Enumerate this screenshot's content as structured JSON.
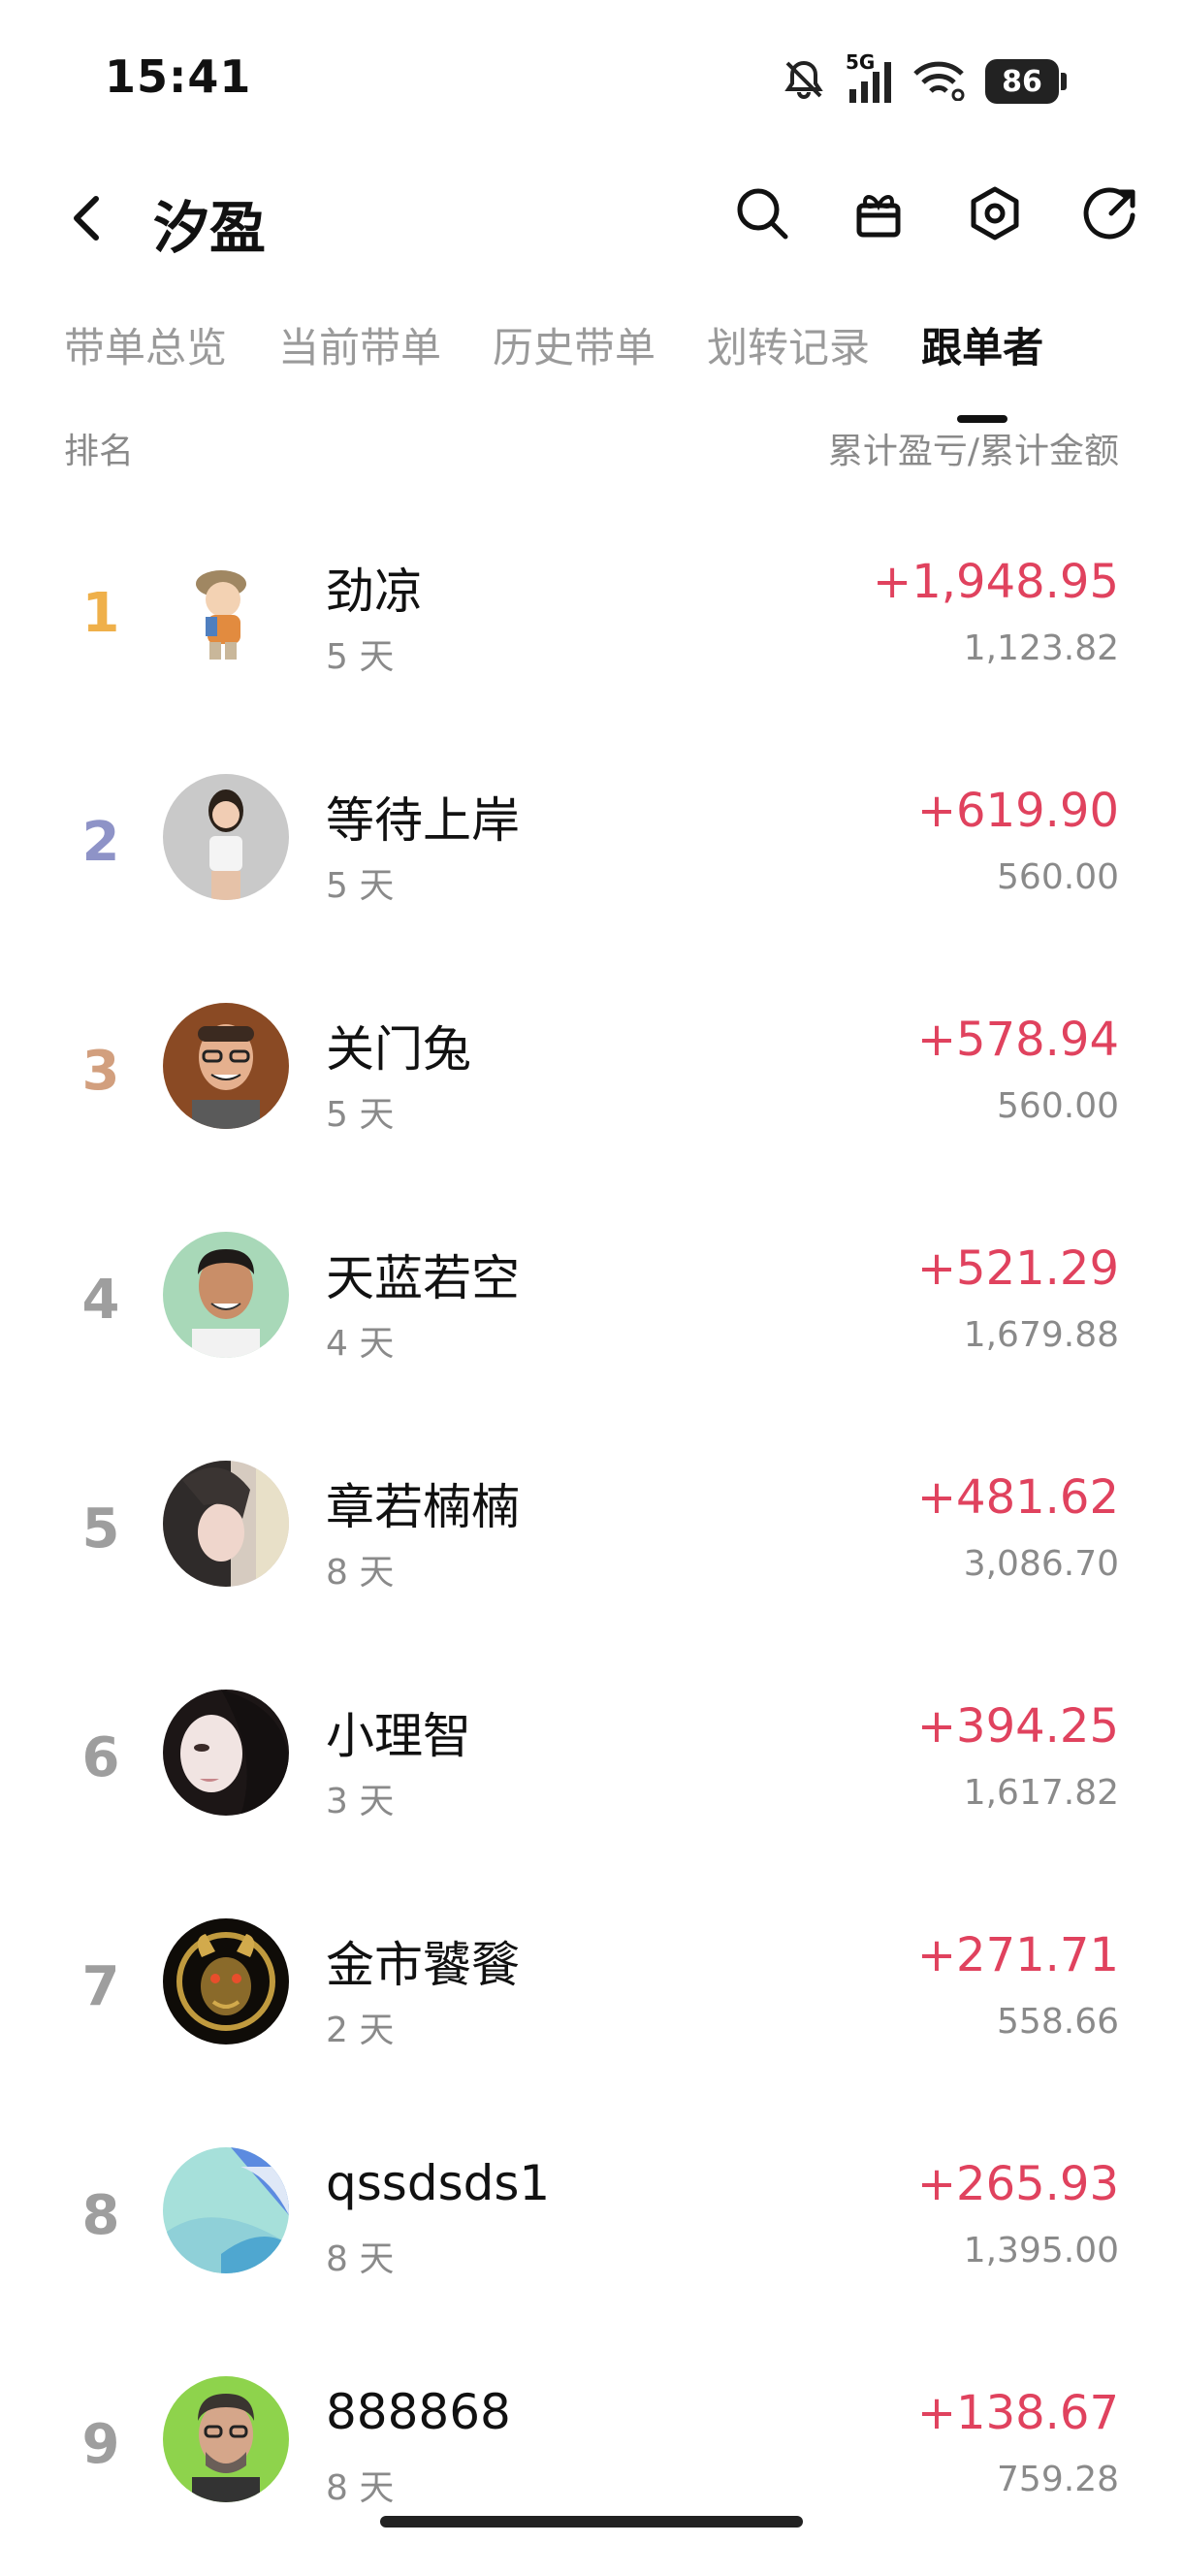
{
  "status_bar": {
    "time": "15:41",
    "network": "5G",
    "battery": "86"
  },
  "header": {
    "title": "汐盈",
    "icons": [
      "back-icon",
      "search-icon",
      "gift-icon",
      "settings-icon",
      "share-icon"
    ]
  },
  "tabs": [
    {
      "label": "带单总览",
      "active": false
    },
    {
      "label": "当前带单",
      "active": false
    },
    {
      "label": "历史带单",
      "active": false
    },
    {
      "label": "划转记录",
      "active": false
    },
    {
      "label": "跟单者",
      "active": true
    }
  ],
  "columns": {
    "left": "排名",
    "right": "累计盈亏/累计金额"
  },
  "followers": [
    {
      "rank": "1",
      "name": "劲凉",
      "days": "5 天",
      "pnl": "+1,948.95",
      "amount": "1,123.82"
    },
    {
      "rank": "2",
      "name": "等待上岸",
      "days": "5 天",
      "pnl": "+619.90",
      "amount": "560.00"
    },
    {
      "rank": "3",
      "name": "关门兔",
      "days": "5 天",
      "pnl": "+578.94",
      "amount": "560.00"
    },
    {
      "rank": "4",
      "name": "天蓝若空",
      "days": "4 天",
      "pnl": "+521.29",
      "amount": "1,679.88"
    },
    {
      "rank": "5",
      "name": "章若楠楠",
      "days": "8 天",
      "pnl": "+481.62",
      "amount": "3,086.70"
    },
    {
      "rank": "6",
      "name": "小理智",
      "days": "3 天",
      "pnl": "+394.25",
      "amount": "1,617.82"
    },
    {
      "rank": "7",
      "name": "金市饕餮",
      "days": "2 天",
      "pnl": "+271.71",
      "amount": "558.66"
    },
    {
      "rank": "8",
      "name": "qssdsds1",
      "days": "8 天",
      "pnl": "+265.93",
      "amount": "1,395.00"
    },
    {
      "rank": "9",
      "name": "888868",
      "days": "8 天",
      "pnl": "+138.67",
      "amount": "759.28"
    }
  ],
  "colors": {
    "profit": "#e0425e",
    "rank1": "#efb04a",
    "rank2": "#8e93c7",
    "rank3": "#d29f7e",
    "muted": "#8a8a8a"
  }
}
